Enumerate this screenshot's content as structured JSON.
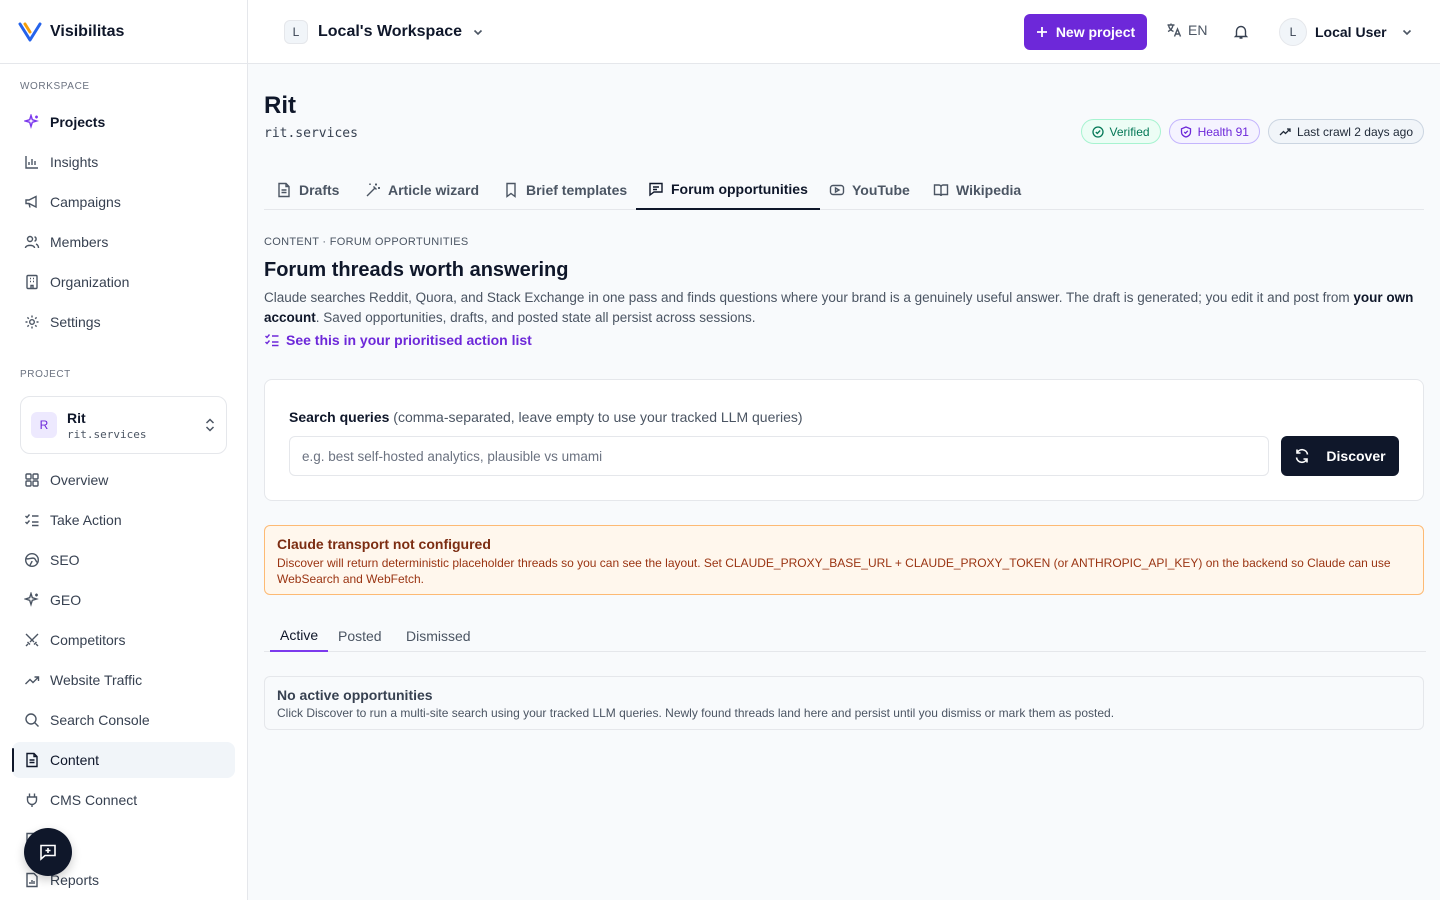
{
  "brand": {
    "name": "Visibilitas"
  },
  "sidebar": {
    "workspace_label": "WORKSPACE",
    "workspace_items": [
      {
        "label": "Projects",
        "icon": "sparkles-icon",
        "active": true
      },
      {
        "label": "Insights",
        "icon": "bar-chart-icon"
      },
      {
        "label": "Campaigns",
        "icon": "megaphone-icon"
      },
      {
        "label": "Members",
        "icon": "users-icon"
      },
      {
        "label": "Organization",
        "icon": "building-icon"
      },
      {
        "label": "Settings",
        "icon": "gear-icon"
      }
    ],
    "project_label": "PROJECT",
    "project": {
      "initial": "R",
      "name": "Rit",
      "domain": "rit.services"
    },
    "project_items": [
      {
        "label": "Overview",
        "icon": "grid-icon"
      },
      {
        "label": "Take Action",
        "icon": "checklist-icon"
      },
      {
        "label": "SEO",
        "icon": "globe-icon"
      },
      {
        "label": "GEO",
        "icon": "sparkles-icon"
      },
      {
        "label": "Competitors",
        "icon": "swords-icon"
      },
      {
        "label": "Website Traffic",
        "icon": "trending-up-icon"
      },
      {
        "label": "Search Console",
        "icon": "search-icon"
      },
      {
        "label": "Content",
        "icon": "file-text-icon",
        "active": true
      },
      {
        "label": "CMS Connect",
        "icon": "plug-icon"
      },
      {
        "label": "es",
        "icon": "file-icon"
      },
      {
        "label": "Reports",
        "icon": "report-icon"
      }
    ]
  },
  "topbar": {
    "workspace_initial": "L",
    "workspace_name": "Local's Workspace",
    "new_project_label": "New project",
    "language": "EN",
    "user_initial": "L",
    "user_name": "Local User"
  },
  "page": {
    "title": "Rit",
    "domain": "rit.services",
    "badges": {
      "verified": "Verified",
      "health": "Health 91",
      "last_crawl": "Last crawl 2 days ago"
    },
    "tabs": [
      {
        "label": "Drafts",
        "icon": "file-text-icon"
      },
      {
        "label": "Article wizard",
        "icon": "wand-icon"
      },
      {
        "label": "Brief templates",
        "icon": "bookmark-icon"
      },
      {
        "label": "Forum opportunities",
        "icon": "message-square-icon",
        "active": true
      },
      {
        "label": "YouTube",
        "icon": "youtube-icon"
      },
      {
        "label": "Wikipedia",
        "icon": "book-open-icon"
      }
    ],
    "breadcrumb": "CONTENT · FORUM OPPORTUNITIES",
    "heading": "Forum threads worth answering",
    "description_part1": "Claude searches Reddit, Quora, and Stack Exchange in one pass and finds questions where your brand is a genuinely useful answer. The draft is generated; you edit it and post from ",
    "description_bold": "your own account",
    "description_part2": ". Saved opportunities, drafts, and posted state all persist across sessions.",
    "action_link": "See this in your prioritised action list"
  },
  "search": {
    "label": "Search queries",
    "hint": "(comma-separated, leave empty to use your tracked LLM queries)",
    "placeholder": "e.g. best self-hosted analytics, plausible vs umami",
    "value": "",
    "button": "Discover"
  },
  "warning": {
    "title": "Claude transport not configured",
    "body": "Discover will return deterministic placeholder threads so you can see the layout. Set CLAUDE_PROXY_BASE_URL + CLAUDE_PROXY_TOKEN (or ANTHROPIC_API_KEY) on the backend so Claude can use WebSearch and WebFetch."
  },
  "subtabs": [
    {
      "label": "Active",
      "active": true
    },
    {
      "label": "Posted"
    },
    {
      "label": "Dismissed"
    }
  ],
  "empty": {
    "title": "No active opportunities",
    "body": "Click Discover to run a multi-site search using your tracked LLM queries. Newly found threads land here and persist until you dismiss or mark them as posted."
  },
  "colors": {
    "accent": "#6d28d9",
    "dark": "#0f172a",
    "warning_bg": "#fff7ed"
  }
}
